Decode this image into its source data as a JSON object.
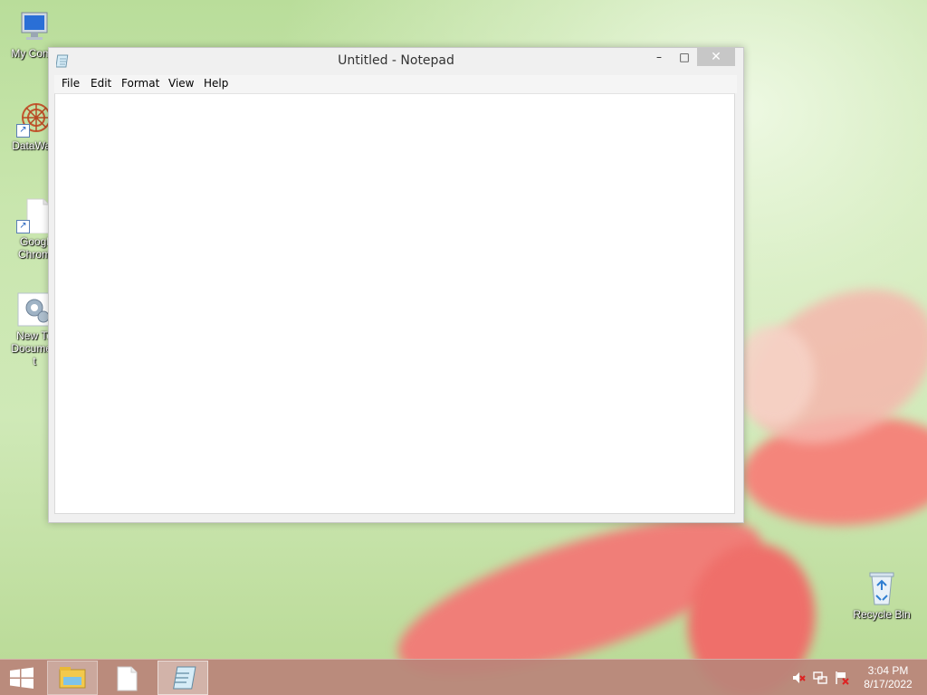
{
  "window": {
    "title": "Untitled - Notepad",
    "controls": {
      "minimize": "–",
      "maximize": "□",
      "close": "✕"
    },
    "menu": [
      "File",
      "Edit",
      "Format",
      "View",
      "Help"
    ],
    "content": ""
  },
  "desktop_icons": [
    {
      "label_line1": "My Comp",
      "label_line2": "",
      "label_line3": "",
      "icon": "computer-icon"
    },
    {
      "label_line1": "DataWag",
      "label_line2": "",
      "label_line3": "",
      "icon": "datawag-icon"
    },
    {
      "label_line1": "Googl",
      "label_line2": "Chrom",
      "label_line3": "",
      "icon": "chrome-shortcut-icon"
    },
    {
      "label_line1": "New Te",
      "label_line2": "Documen",
      "label_line3": "t",
      "icon": "text-document-icon"
    },
    {
      "label_line1": "Recycle Bin",
      "label_line2": "",
      "label_line3": "",
      "icon": "recycle-bin-icon"
    }
  ],
  "taskbar": {
    "start_icon": "windows-logo-icon",
    "apps": [
      "file-explorer-icon",
      "blank-file-icon",
      "notepad-icon"
    ],
    "tray_icons": [
      "volume-muted-icon",
      "network-icon",
      "action-center-flag-icon"
    ],
    "time": "3:04 PM",
    "date": "8/17/2022"
  },
  "colors": {
    "taskbar": "#ba847a",
    "close_button": "#c7c7c7",
    "window_frame": "#f0f0f0"
  }
}
